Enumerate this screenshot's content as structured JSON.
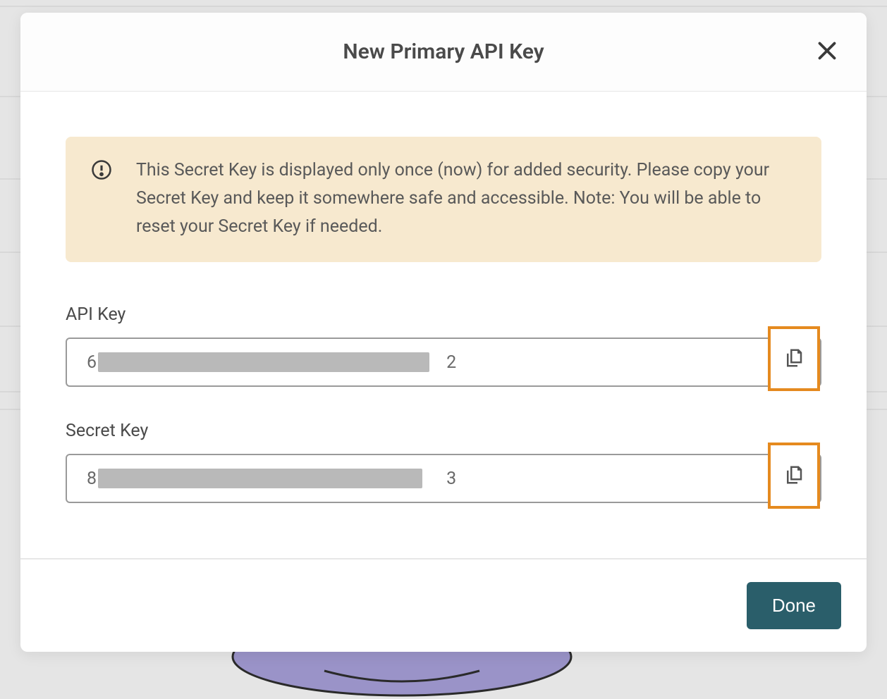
{
  "modal": {
    "title": "New Primary API Key",
    "warning": "This Secret Key is displayed only once (now) for added security. Please copy your Secret Key and keep it somewhere safe and accessible. Note: You will be able to reset your Secret Key if needed.",
    "fields": {
      "api_key": {
        "label": "API Key",
        "value_prefix": "6",
        "value_suffix": "2"
      },
      "secret_key": {
        "label": "Secret Key",
        "value_prefix": "8",
        "value_suffix": "3"
      }
    },
    "done_label": "Done"
  }
}
